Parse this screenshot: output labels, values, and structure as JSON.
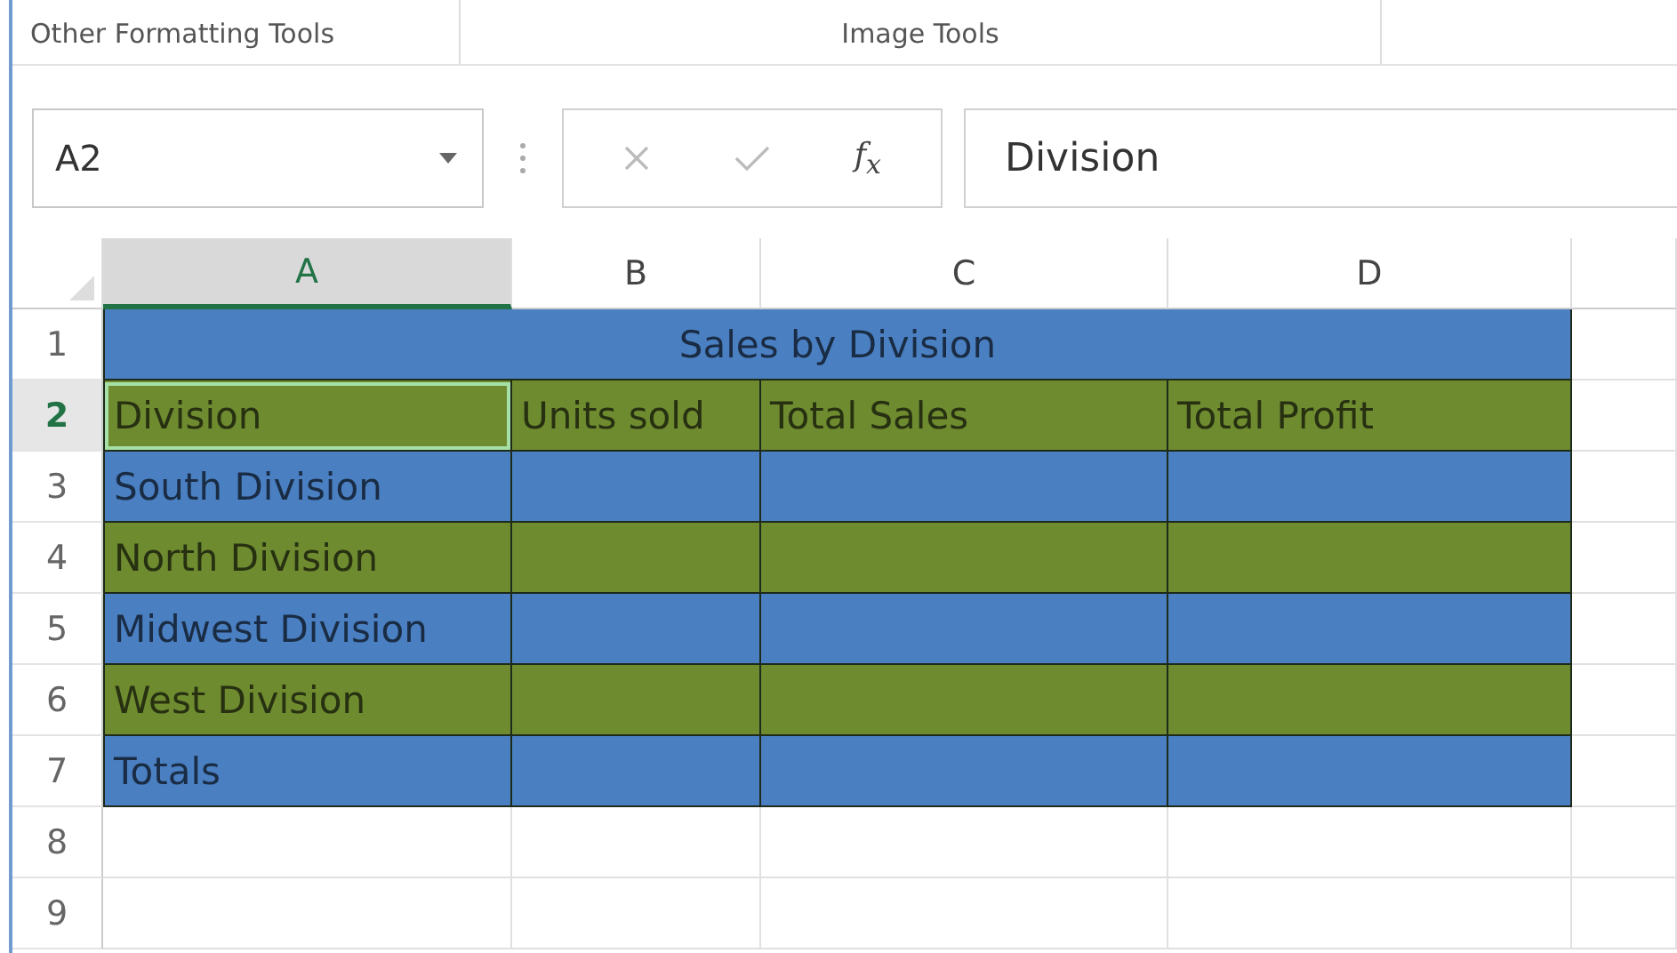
{
  "ribbon_groups": [
    {
      "label": "Other Formatting Tools"
    },
    {
      "label": "Image Tools"
    }
  ],
  "formula_bar": {
    "name_box": "A2",
    "function_label": "f$_{x}$",
    "value": "Division"
  },
  "sheet": {
    "columns": [
      {
        "label": "A",
        "selected": true
      },
      {
        "label": "B",
        "selected": false
      },
      {
        "label": "C",
        "selected": false
      },
      {
        "label": "D",
        "selected": false
      }
    ],
    "rows": [
      {
        "header": "1",
        "selected": false,
        "kind": "title",
        "color": "#4a7fc1",
        "cells": [
          {
            "text": "Sales by Division",
            "selected": false
          }
        ]
      },
      {
        "header": "2",
        "selected": true,
        "kind": "data",
        "color": "#6e8b30",
        "cells": [
          {
            "text": "Division",
            "selected": true
          },
          {
            "text": "Units sold",
            "selected": false
          },
          {
            "text": "Total Sales",
            "selected": false
          },
          {
            "text": "Total Profit",
            "selected": false
          }
        ]
      },
      {
        "header": "3",
        "selected": false,
        "kind": "data",
        "color": "#4a7fc1",
        "cells": [
          {
            "text": "South Division",
            "selected": false
          },
          {
            "selected": false
          },
          {
            "selected": false
          },
          {
            "selected": false
          }
        ]
      },
      {
        "header": "4",
        "selected": false,
        "kind": "data",
        "color": "#6e8b30",
        "cells": [
          {
            "text": "North Division",
            "selected": false
          },
          {
            "selected": false
          },
          {
            "selected": false
          },
          {
            "selected": false
          }
        ]
      },
      {
        "header": "5",
        "selected": false,
        "kind": "data",
        "color": "#4a7fc1",
        "cells": [
          {
            "text": "Midwest Division",
            "selected": false
          },
          {
            "selected": false
          },
          {
            "selected": false
          },
          {
            "selected": false
          }
        ]
      },
      {
        "header": "6",
        "selected": false,
        "kind": "data",
        "color": "#6e8b30",
        "cells": [
          {
            "text": "West Division",
            "selected": false
          },
          {
            "selected": false
          },
          {
            "selected": false
          },
          {
            "selected": false
          }
        ]
      },
      {
        "header": "7",
        "selected": false,
        "kind": "data",
        "color": "#4a7fc1",
        "cells": [
          {
            "text": "Totals",
            "selected": false
          },
          {
            "selected": false
          },
          {
            "selected": false
          },
          {
            "selected": false
          }
        ]
      },
      {
        "header": "8",
        "selected": false,
        "kind": "empty"
      },
      {
        "header": "9",
        "selected": false,
        "kind": "empty"
      }
    ]
  }
}
